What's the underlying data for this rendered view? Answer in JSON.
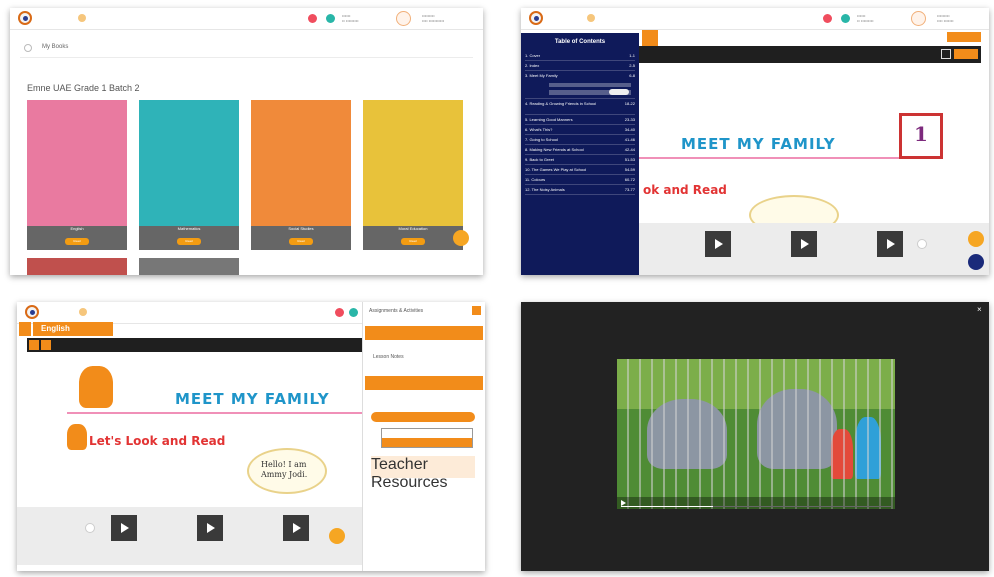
{
  "colors": {
    "accent": "#f28c1a",
    "navy": "#0f1a5a",
    "title_blue": "#1f95c9",
    "title_red": "#e23434"
  },
  "panel1": {
    "breadcrumb": "My Books",
    "shelf_title": "Emne UAE Grade 1 Batch 2",
    "books": [
      {
        "label": "English",
        "button": "Read",
        "color": "#e97aa0"
      },
      {
        "label": "Mathematics",
        "button": "Read",
        "color": "#2fb3b8"
      },
      {
        "label": "Social Studies",
        "button": "Read",
        "color": "#f08a3a"
      },
      {
        "label": "Moral Education",
        "button": "Read",
        "color": "#e8c23a"
      }
    ]
  },
  "panel2": {
    "toc_title": "Table of Contents",
    "toc_items": [
      {
        "title": "1. Cover",
        "page": "1-1"
      },
      {
        "title": "2. Index",
        "page": "2-5"
      },
      {
        "title": "3. Meet My Family",
        "page": "6-8"
      },
      {
        "title": "4. Reading & Growing Friends in School",
        "page": "18-22"
      },
      {
        "title": "5. Learning Good Manners",
        "page": "23-33"
      },
      {
        "title": "6. What's This?",
        "page": "34-40"
      },
      {
        "title": "7. Going to School",
        "page": "41-46"
      },
      {
        "title": "8. Making New Friends at School",
        "page": "42-44"
      },
      {
        "title": "9. Back to Greet",
        "page": "51-53"
      },
      {
        "title": "10. The Games We Play at School",
        "page": "54-59"
      },
      {
        "title": "11. Colours",
        "page": "60-72"
      },
      {
        "title": "12. The Noisy Animals",
        "page": "73-77"
      }
    ],
    "page_title": "MEET MY FAMILY",
    "subtitle": "ok and Read"
  },
  "panel3": {
    "subject": "English",
    "page_title": "MEET MY FAMILY",
    "subtitle": "Let's Look and Read",
    "speech": "Hello! I am Ammy Jodi.",
    "sidebar_items": [
      "Assignments & Activities",
      "Lesson Notes",
      "Teacher Resources"
    ]
  }
}
